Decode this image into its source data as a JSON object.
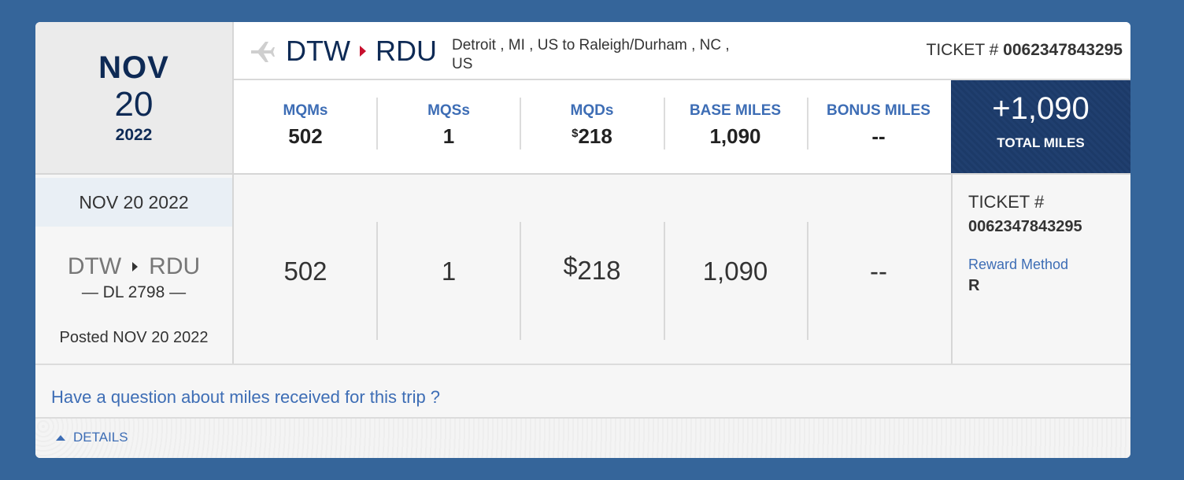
{
  "date_block": {
    "month": "NOV",
    "day": "20",
    "year": "2022"
  },
  "route": {
    "origin": "DTW",
    "destination": "RDU",
    "description": "Detroit , MI , US to Raleigh/Durham , NC , US",
    "ticket_label": "TICKET #",
    "ticket_number": "0062347843295"
  },
  "stats": [
    {
      "label": "MQMs",
      "value": "502"
    },
    {
      "label": "MQSs",
      "value": "1"
    },
    {
      "label": "MQDs",
      "currency": "$",
      "value": "218"
    },
    {
      "label": "BASE MILES",
      "value": "1,090"
    },
    {
      "label": "BONUS MILES",
      "value": "--"
    }
  ],
  "total": {
    "value": "+1,090",
    "label": "TOTAL MILES"
  },
  "segment": {
    "date": "NOV 20 2022",
    "origin": "DTW",
    "destination": "RDU",
    "flight": "— DL 2798 —",
    "posted": "Posted NOV 20 2022",
    "mqm": "502",
    "mqs": "1",
    "mqd_currency": "$",
    "mqd": "218",
    "base_miles": "1,090",
    "bonus_miles": "--",
    "ticket_label": "TICKET #",
    "ticket_number": "0062347843295",
    "reward_method_label": "Reward Method",
    "reward_method_value": "R"
  },
  "question_link": "Have a question about miles received for this trip ?",
  "details_label": "DETAILS",
  "colors": {
    "background": "#35659a",
    "accent_blue": "#3d6db5",
    "navy": "#0e2a55",
    "total_bg": "#1c3a68",
    "route_arrow": "#c8102e"
  },
  "icons": [
    "plane-icon",
    "caret-right-icon",
    "caret-up-icon"
  ]
}
